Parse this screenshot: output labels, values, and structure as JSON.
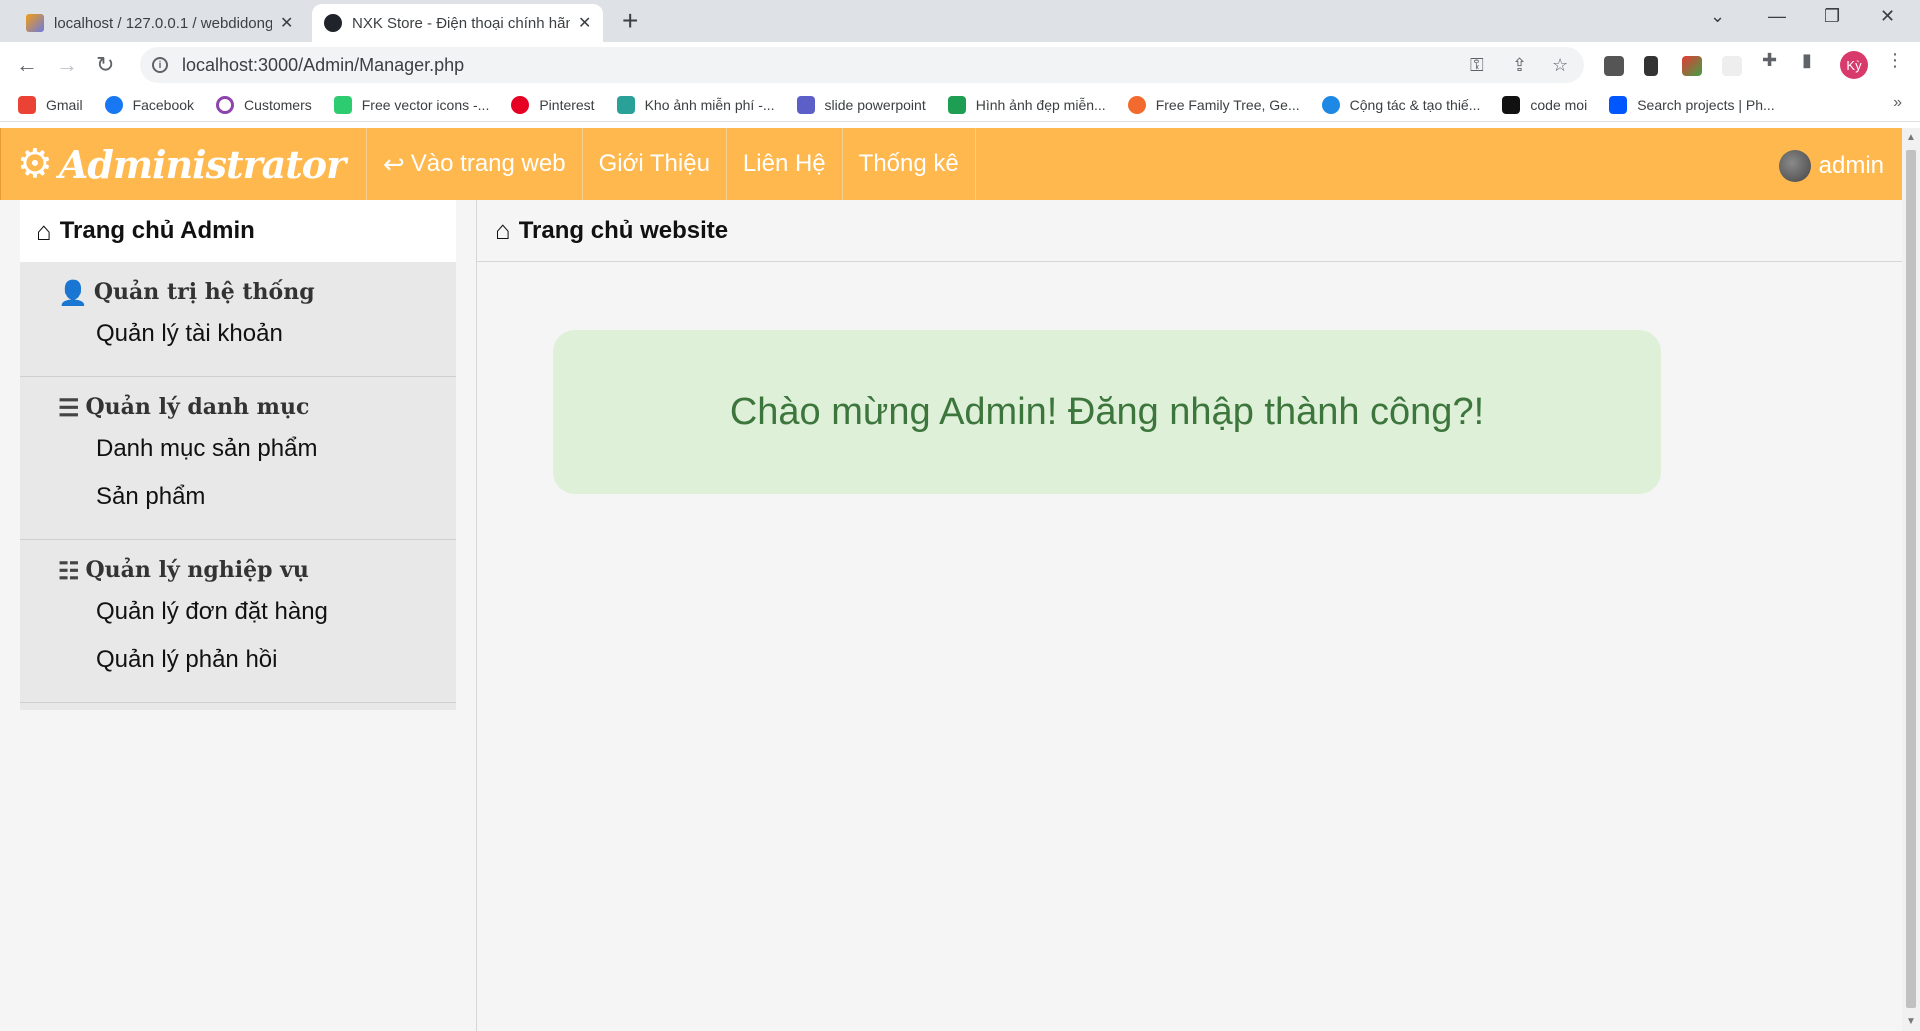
{
  "browser": {
    "tabs": [
      {
        "title": "localhost / 127.0.0.1 / webdidong",
        "icon": "phpmyadmin-icon",
        "active": false
      },
      {
        "title": "NXK Store - Điện thoại chính hãng",
        "icon": "react-icon",
        "active": true
      }
    ],
    "new_tab": "+",
    "url": "localhost:3000/Admin/Manager.php",
    "profile_initials": "Kỳ",
    "bookmarks": [
      {
        "label": "Gmail",
        "icon": "gmail-icon",
        "color": "#ea4335"
      },
      {
        "label": "Facebook",
        "icon": "facebook-icon",
        "color": "#1877f2"
      },
      {
        "label": "Customers",
        "icon": "circle-icon",
        "color": "#8e44ad"
      },
      {
        "label": "Free vector icons -...",
        "icon": "vector-icon",
        "color": "#2ecc71"
      },
      {
        "label": "Pinterest",
        "icon": "pinterest-icon",
        "color": "#e60023"
      },
      {
        "label": "Kho ảnh miễn phí -...",
        "icon": "image-icon",
        "color": "#2aa198"
      },
      {
        "label": "slide powerpoint",
        "icon": "slides-icon",
        "color": "#5b5fc7"
      },
      {
        "label": "Hình ảnh đẹp miễn...",
        "icon": "px-icon",
        "color": "#1e9e52"
      },
      {
        "label": "Free Family Tree, Ge...",
        "icon": "familytree-icon",
        "color": "#f26a2e"
      },
      {
        "label": "Cộng tác & tạo thiế...",
        "icon": "canva-icon",
        "color": "#1e88e5"
      },
      {
        "label": "code moi",
        "icon": "code-icon",
        "color": "#111111"
      },
      {
        "label": "Search projects | Ph...",
        "icon": "behance-icon",
        "color": "#0057ff"
      }
    ]
  },
  "topnav": {
    "brand": "Administrator",
    "links": [
      "Vào trang web",
      "Giới Thiệu",
      "Liên Hệ",
      "Thống kê"
    ],
    "user": "admin",
    "bg_color": "#ffb84d"
  },
  "sidebar": {
    "home": "Trang chủ Admin",
    "groups": [
      {
        "title": "Quản trị hệ thống",
        "icon": "user-icon",
        "items": [
          "Quản lý tài khoản"
        ]
      },
      {
        "title": "Quản lý danh mục",
        "icon": "list-icon",
        "items": [
          "Danh mục sản phẩm",
          "Sản phẩm"
        ]
      },
      {
        "title": "Quản lý nghiệp vụ",
        "icon": "stack-icon",
        "items": [
          "Quản lý đơn đặt hàng",
          "Quản lý phản hồi"
        ]
      }
    ]
  },
  "content": {
    "heading": "Trang chủ website",
    "welcome": "Chào mừng Admin! Đăng nhập thành công?!"
  }
}
